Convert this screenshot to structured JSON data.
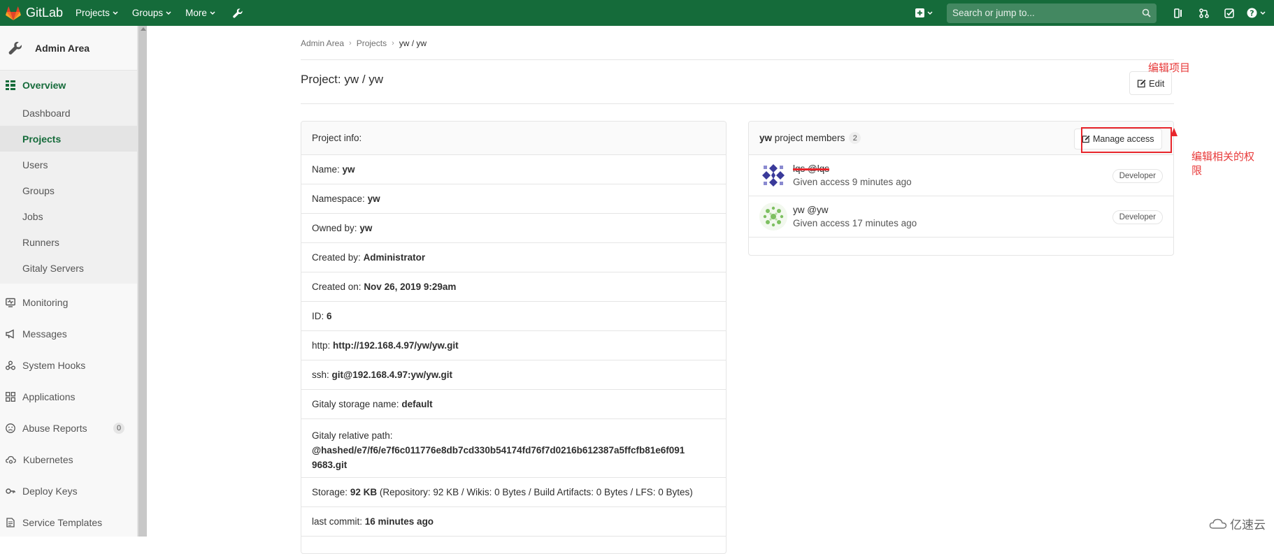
{
  "topbar": {
    "brand": "GitLab",
    "nav": [
      "Projects",
      "Groups",
      "More"
    ],
    "search_placeholder": "Search or jump to..."
  },
  "sidebar": {
    "title": "Admin Area",
    "overview": "Overview",
    "sub_items": [
      "Dashboard",
      "Projects",
      "Users",
      "Groups",
      "Jobs",
      "Runners",
      "Gitaly Servers"
    ],
    "items": [
      "Monitoring",
      "Messages",
      "System Hooks",
      "Applications",
      "Abuse Reports",
      "Kubernetes",
      "Deploy Keys",
      "Service Templates"
    ],
    "abuse_count": "0"
  },
  "breadcrumb": [
    "Admin Area",
    "Projects",
    "yw / yw"
  ],
  "page_title": "Project: yw / yw",
  "edit_label": "Edit",
  "annotations": {
    "edit": "编辑项目",
    "manage_line1": "编辑相关的权",
    "manage_line2": "限"
  },
  "project_info": {
    "header": "Project info:",
    "name_label": "Name:",
    "name": "yw",
    "namespace_label": "Namespace:",
    "namespace": "yw",
    "owned_label": "Owned by:",
    "owned": "yw",
    "created_by_label": "Created by:",
    "created_by": "Administrator",
    "created_on_label": "Created on:",
    "created_on": "Nov 26, 2019 9:29am",
    "id_label": "ID:",
    "id": "6",
    "http_label": "http:",
    "http": "http://192.168.4.97/yw/yw.git",
    "ssh_label": "ssh:",
    "ssh": "git@192.168.4.97:yw/yw.git",
    "gitaly_name_label": "Gitaly storage name:",
    "gitaly_name": "default",
    "gitaly_path_label": "Gitaly relative path:",
    "gitaly_path_1": "@hashed/e7/f6/e7f6c011776e8db7cd330b54174fd76f7d0216b612387a5ffcfb81e6f091",
    "gitaly_path_2": "9683.git",
    "storage_label": "Storage:",
    "storage_value": "92 KB",
    "storage_detail": "(Repository: 92 KB / Wikis: 0 Bytes / Build Artifacts: 0 Bytes / LFS: 0 Bytes)",
    "last_commit_label": "last commit:",
    "last_commit": "16 minutes ago"
  },
  "members": {
    "group": "yw",
    "title_suffix": "project members",
    "count": "2",
    "manage_label": "Manage access",
    "list": [
      {
        "name": "lqs @lqs",
        "access": "Given access 9 minutes ago",
        "role": "Developer"
      },
      {
        "name": "yw @yw",
        "access": "Given access 17 minutes ago",
        "role": "Developer"
      }
    ]
  },
  "watermark": "亿速云",
  "colors": {
    "nav": "#156b3a",
    "annotation": "#e83a3a"
  }
}
